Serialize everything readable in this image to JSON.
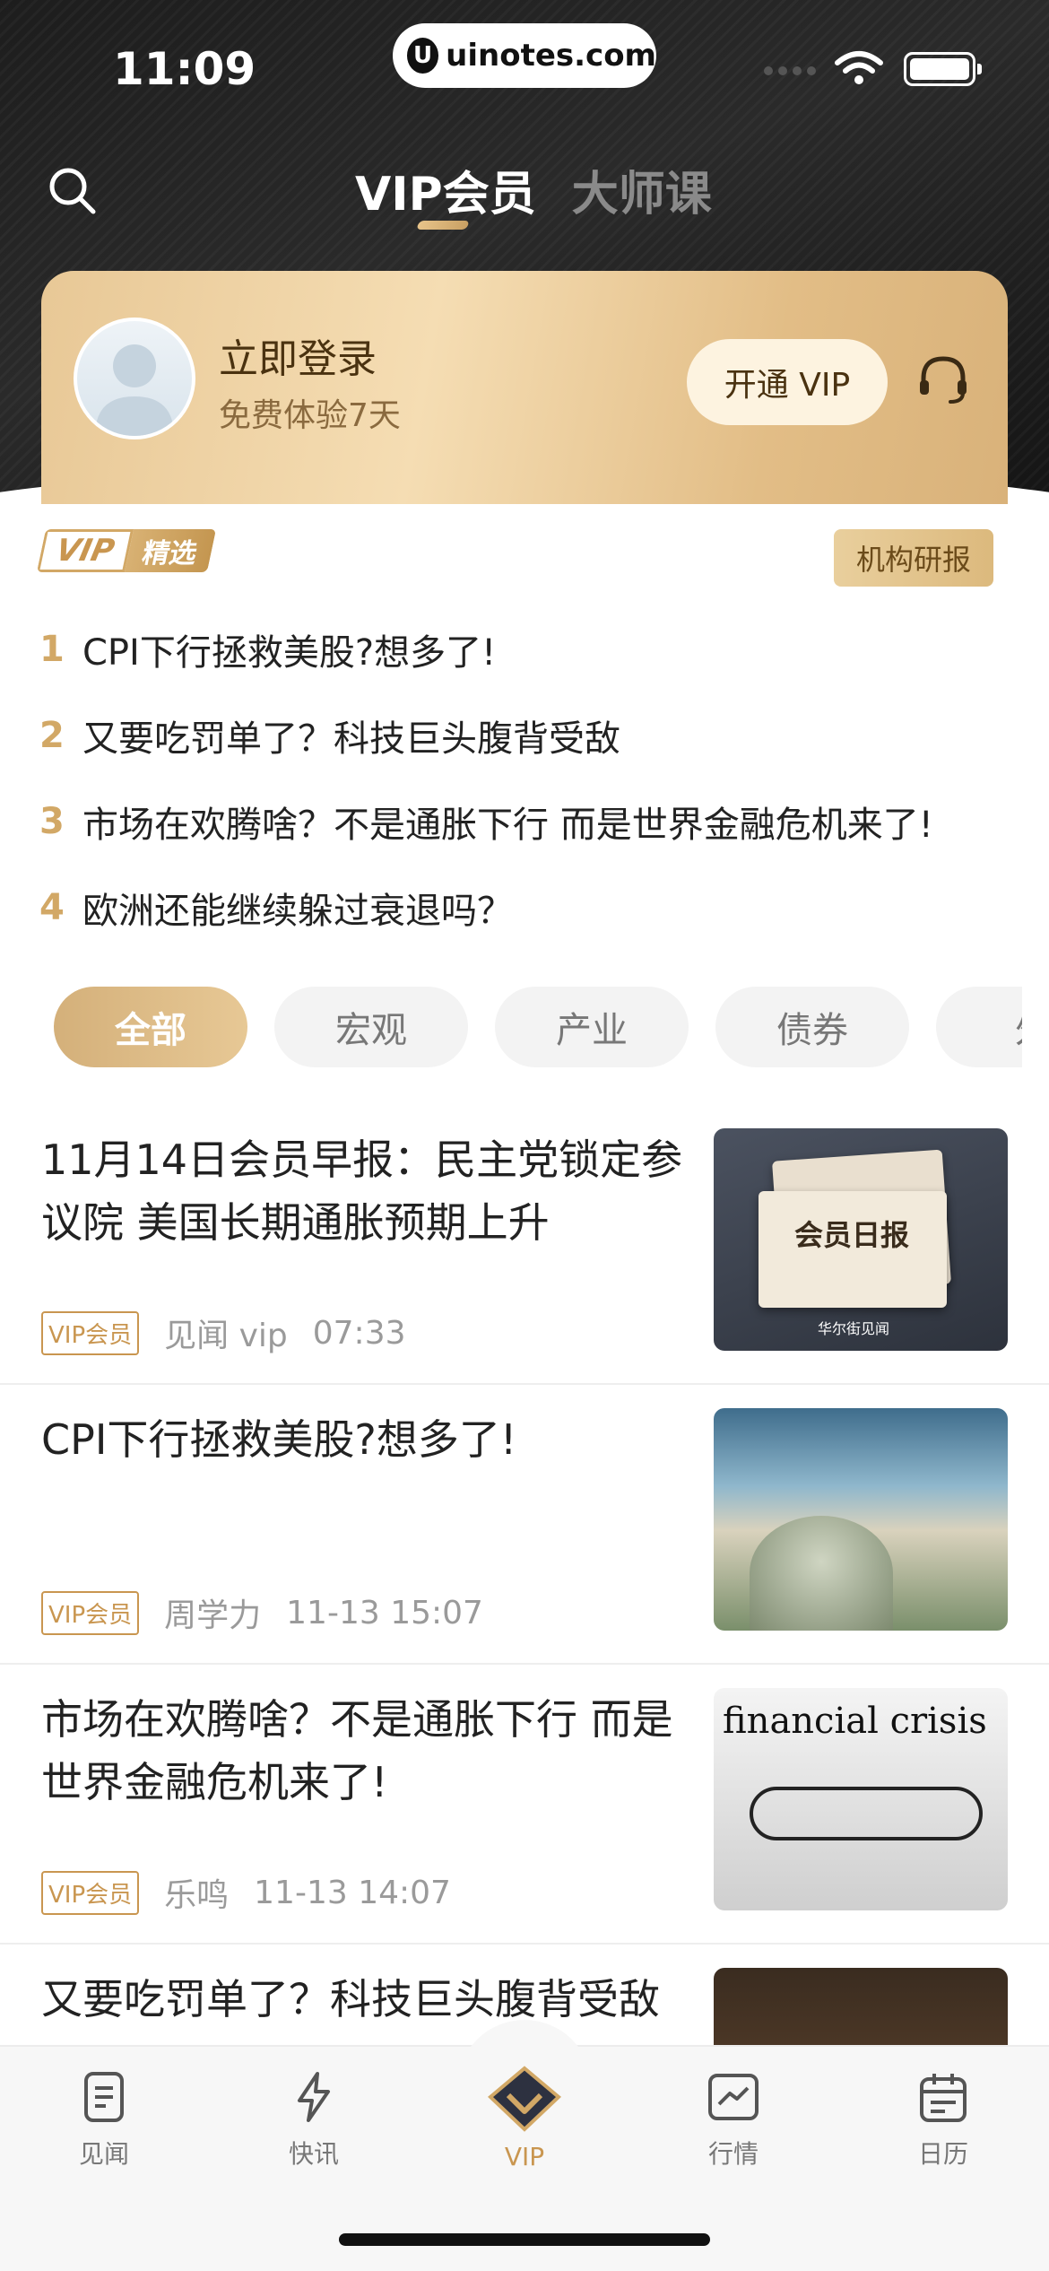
{
  "status_bar": {
    "time": "11:09",
    "url": "uinotes.com"
  },
  "header": {
    "tabs": [
      {
        "label": "VIP会员",
        "active": true
      },
      {
        "label": "大师课",
        "active": false
      }
    ]
  },
  "member_card": {
    "login_title": "立即登录",
    "login_subtitle": "免费体验7天",
    "open_vip_label": "开通 VIP"
  },
  "vip_pick": {
    "badge_vip": "VIP",
    "badge_select": "精选",
    "inst_tag": "机构研报",
    "items": [
      {
        "num": "1",
        "text": "CPI下行拯救美股?想多了!"
      },
      {
        "num": "2",
        "text": "又要吃罚单了？科技巨头腹背受敌"
      },
      {
        "num": "3",
        "text": "市场在欢腾啥？不是通胀下行 而是世界金融危机来了!"
      },
      {
        "num": "4",
        "text": "欧洲还能继续躲过衰退吗？"
      }
    ]
  },
  "categories": [
    {
      "label": "全部",
      "active": true
    },
    {
      "label": "宏观",
      "active": false
    },
    {
      "label": "产业",
      "active": false
    },
    {
      "label": "债券",
      "active": false
    },
    {
      "label": "外",
      "active": false
    }
  ],
  "articles": [
    {
      "title": "11月14日会员早报：民主党锁定参议院 美国长期通胀预期上升",
      "tag": "VIP会员",
      "author": "见闻 vip",
      "time": "07:33",
      "thumb_text": "会员日报",
      "thumb_logo": "华尔街见闻"
    },
    {
      "title": "CPI下行拯救美股?想多了!",
      "tag": "VIP会员",
      "author": "周学力",
      "time": "11-13 15:07"
    },
    {
      "title": "市场在欢腾啥？不是通胀下行 而是世界金融危机来了!",
      "tag": "VIP会员",
      "author": "乐鸣",
      "time": "11-13 14:07",
      "thumb_text": "financial crisis"
    },
    {
      "title": "又要吃罚单了？科技巨头腹背受敌"
    }
  ],
  "bottom_nav": [
    {
      "label": "见闻",
      "icon": "document-icon"
    },
    {
      "label": "快讯",
      "icon": "lightning-icon"
    },
    {
      "label": "VIP",
      "icon": "vip-diamond-icon",
      "active": true
    },
    {
      "label": "行情",
      "icon": "chart-icon"
    },
    {
      "label": "日历",
      "icon": "calendar-icon"
    }
  ],
  "colors": {
    "gold": "#c99650",
    "dark": "#1d1d1d"
  }
}
